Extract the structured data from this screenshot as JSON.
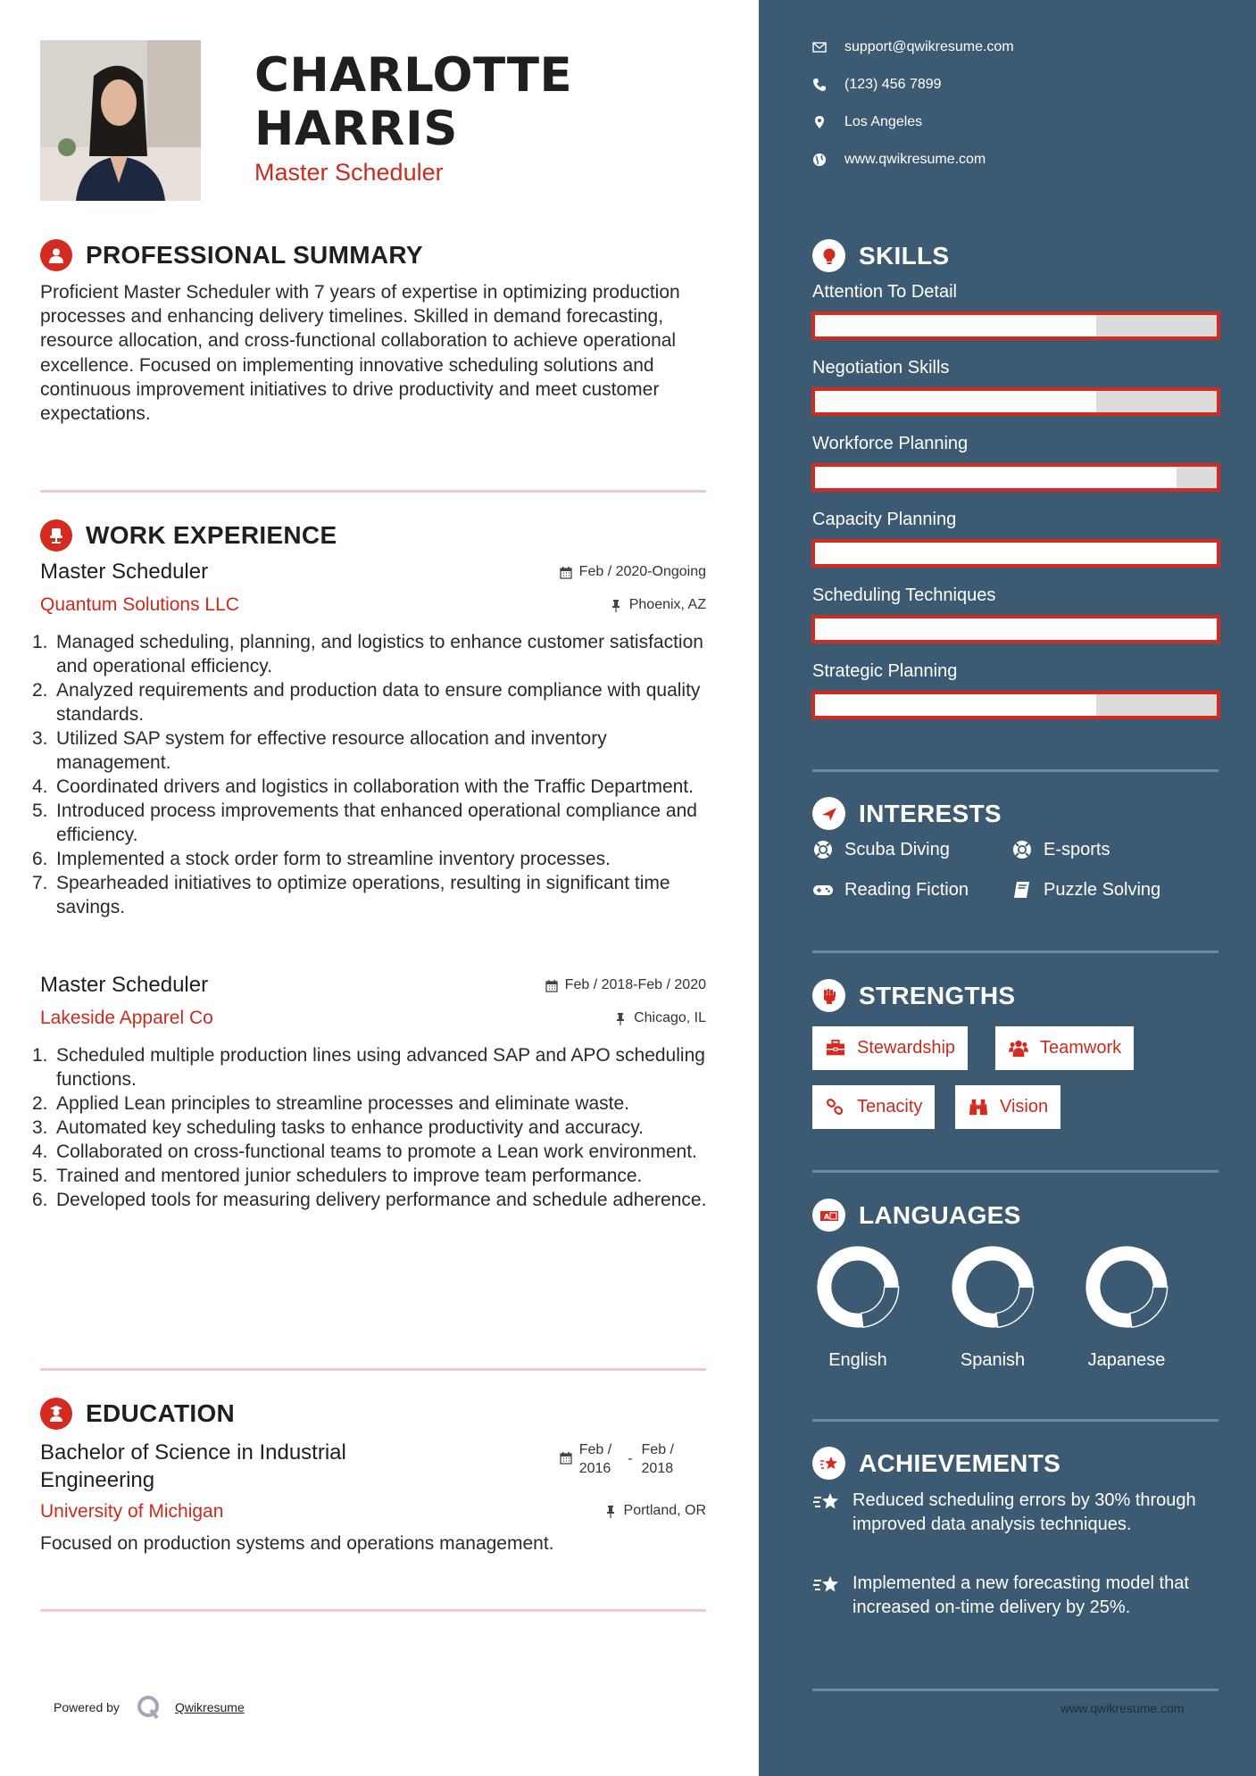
{
  "header": {
    "name_line1": "CHARLOTTE",
    "name_line2": "HARRIS",
    "title": "Master Scheduler"
  },
  "contact": {
    "email": "support@qwikresume.com",
    "phone": "(123) 456 7899",
    "location": "Los Angeles",
    "website": "www.qwikresume.com"
  },
  "summary": {
    "heading": "PROFESSIONAL SUMMARY",
    "text": "Proficient Master Scheduler with 7 years of expertise in optimizing production processes and enhancing delivery timelines. Skilled in demand forecasting, resource allocation, and cross-functional collaboration to achieve operational excellence. Focused on implementing innovative scheduling solutions and continuous improvement initiatives to drive productivity and meet customer expectations."
  },
  "experience": {
    "heading": "WORK EXPERIENCE",
    "jobs": [
      {
        "title": "Master Scheduler",
        "company": "Quantum Solutions LLC",
        "dates": "Feb / 2020-Ongoing",
        "location": "Phoenix, AZ",
        "bullets": [
          "Managed scheduling, planning, and logistics to enhance customer satisfaction and operational efficiency.",
          "Analyzed requirements and production data to ensure compliance with quality standards.",
          "Utilized SAP system for effective resource allocation and inventory management.",
          "Coordinated drivers and logistics in collaboration with the Traffic Department.",
          "Introduced process improvements that enhanced operational compliance and efficiency.",
          "Implemented a stock order form to streamline inventory processes.",
          "Spearheaded initiatives to optimize operations, resulting in significant time savings."
        ]
      },
      {
        "title": "Master Scheduler",
        "company": "Lakeside Apparel Co",
        "dates": "Feb / 2018-Feb / 2020",
        "location": "Chicago, IL",
        "bullets": [
          "Scheduled multiple production lines using advanced SAP and APO scheduling functions.",
          "Applied Lean principles to streamline processes and eliminate waste.",
          "Automated key scheduling tasks to enhance productivity and accuracy.",
          "Collaborated on cross-functional teams to promote a Lean work environment.",
          "Trained and mentored junior schedulers to improve team performance.",
          "Developed tools for measuring delivery performance and schedule adherence."
        ]
      }
    ]
  },
  "education": {
    "heading": "EDUCATION",
    "degree": "Bachelor of Science in Industrial Engineering",
    "school": "University of Michigan",
    "start_month": "Feb /",
    "start_year": "2016",
    "end_month": "Feb /",
    "end_year": "2018",
    "separator": "-",
    "location": "Portland, OR",
    "description": "Focused on production systems and operations management."
  },
  "skills": {
    "heading": "SKILLS",
    "items": [
      {
        "label": "Attention To Detail",
        "level": 0.7
      },
      {
        "label": "Negotiation Skills",
        "level": 0.7
      },
      {
        "label": "Workforce Planning",
        "level": 0.9
      },
      {
        "label": "Capacity Planning",
        "level": 1.0
      },
      {
        "label": "Scheduling Techniques",
        "level": 1.0
      },
      {
        "label": "Strategic Planning",
        "level": 0.7
      }
    ]
  },
  "interests": {
    "heading": "INTERESTS",
    "items": [
      {
        "label": "Scuba Diving",
        "icon": "life-ring-icon"
      },
      {
        "label": "E-sports",
        "icon": "life-ring-icon"
      },
      {
        "label": "Reading Fiction",
        "icon": "gamepad-icon"
      },
      {
        "label": "Puzzle Solving",
        "icon": "book-icon"
      }
    ]
  },
  "strengths": {
    "heading": "STRENGTHS",
    "items": [
      {
        "label": "Stewardship",
        "icon": "briefcase-icon"
      },
      {
        "label": "Teamwork",
        "icon": "users-icon"
      },
      {
        "label": "Tenacity",
        "icon": "link-icon"
      },
      {
        "label": "Vision",
        "icon": "binoculars-icon"
      }
    ]
  },
  "languages": {
    "heading": "LANGUAGES",
    "items": [
      {
        "label": "English",
        "level": 0.77
      },
      {
        "label": "Spanish",
        "level": 0.77
      },
      {
        "label": "Japanese",
        "level": 0.77
      }
    ]
  },
  "achievements": {
    "heading": "ACHIEVEMENTS",
    "items": [
      "Reduced scheduling errors by 30% through improved data analysis techniques.",
      "Implemented a new forecasting model that increased on-time delivery by 25%."
    ]
  },
  "footer": {
    "powered_by": "Powered by",
    "brand": "Qwikresume",
    "website": "www.qwikresume.com"
  },
  "colors": {
    "accent": "#d42b20",
    "sidebar": "#3d5a73"
  }
}
